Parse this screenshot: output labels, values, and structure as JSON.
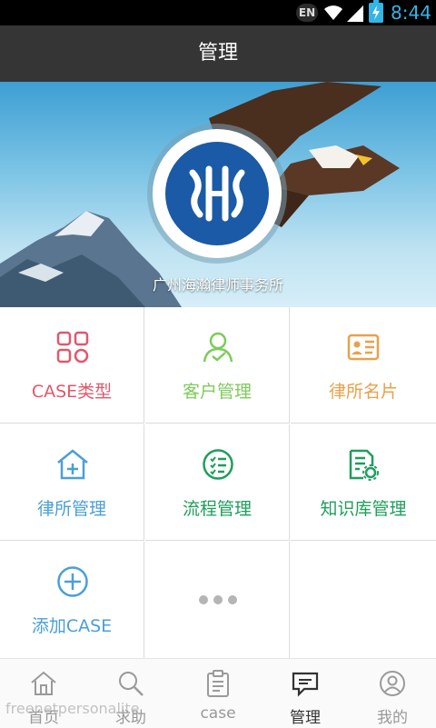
{
  "status_bar": {
    "lang": "EN",
    "time": "8:44"
  },
  "header": {
    "title": "管理"
  },
  "banner": {
    "firm_name": "广州海瀚律师事务所"
  },
  "grid": {
    "items": [
      {
        "label": "CASE类型",
        "icon": "apps-grid-icon",
        "color": "#e0586c"
      },
      {
        "label": "客户管理",
        "icon": "user-check-icon",
        "color": "#7ccc5a"
      },
      {
        "label": "律所名片",
        "icon": "business-card-icon",
        "color": "#e8a14a"
      },
      {
        "label": "律所管理",
        "icon": "house-plus-icon",
        "color": "#4a9fd8"
      },
      {
        "label": "流程管理",
        "icon": "checklist-icon",
        "color": "#1e9e5c"
      },
      {
        "label": "知识库管理",
        "icon": "document-gear-icon",
        "color": "#1e9e5c"
      },
      {
        "label": "添加CASE",
        "icon": "plus-circle-icon",
        "color": "#4a9fd8"
      },
      {
        "label": "",
        "icon": "more-dots-icon",
        "color": "#aaaaaa"
      }
    ]
  },
  "tabbar": {
    "tabs": [
      {
        "label": "首页",
        "icon": "home-icon",
        "active": false
      },
      {
        "label": "求助",
        "icon": "search-icon",
        "active": false
      },
      {
        "label": "case",
        "icon": "clipboard-icon",
        "active": false
      },
      {
        "label": "管理",
        "icon": "chat-bubble-icon",
        "active": true
      },
      {
        "label": "我的",
        "icon": "profile-icon",
        "active": false
      }
    ]
  },
  "watermark": "freenetpersonalite"
}
